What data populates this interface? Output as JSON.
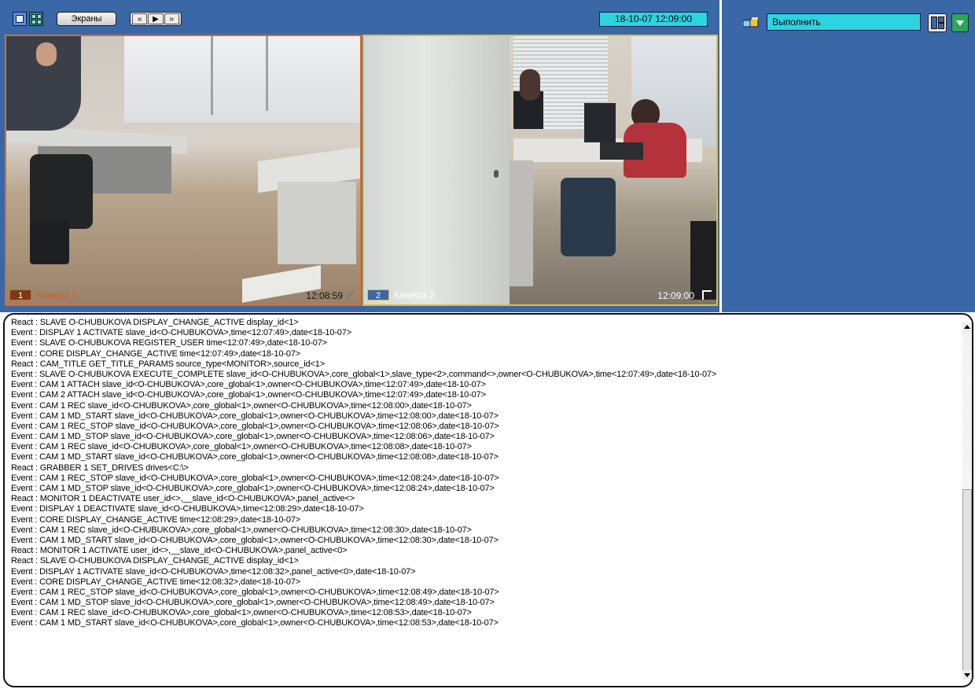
{
  "toolbar": {
    "screens_label": "Экраны",
    "nav_buttons": [
      "«",
      "▶",
      "»"
    ],
    "datetime": "18-10-07  12:09:00"
  },
  "cameras": [
    {
      "number": "1",
      "name": "Камера 1",
      "time": "12:08:59",
      "frame_color": "#e06a24"
    },
    {
      "number": "2",
      "name": "Камера 2",
      "time": "12:09:00",
      "frame_color": "#e0c034"
    }
  ],
  "command_panel": {
    "input_value": "Выполнить"
  },
  "colors": {
    "panel_bg": "#3a67a6",
    "accent_cyan": "#2ed3e0",
    "selected_row": "#0a246a"
  },
  "log": {
    "selected_index": 34,
    "lines": [
      "React : SLAVE O-CHUBUKOVA DISPLAY_CHANGE_ACTIVE display_id<1>",
      "Event : DISPLAY 1 ACTIVATE slave_id<O-CHUBUKOVA>,time<12:07:49>,date<18-10-07>",
      "Event : SLAVE O-CHUBUKOVA REGISTER_USER time<12:07:49>,date<18-10-07>",
      "Event : CORE  DISPLAY_CHANGE_ACTIVE time<12:07:49>,date<18-10-07>",
      "React : CAM_TITLE  GET_TITLE_PARAMS source_type<MONITOR>,source_id<1>",
      "Event : SLAVE O-CHUBUKOVA EXECUTE_COMPLETE slave_id<O-CHUBUKOVA>,core_global<1>,slave_type<2>,command<>,owner<O-CHUBUKOVA>,time<12:07:49>,date<18-10-07>",
      "Event : CAM 1 ATTACH slave_id<O-CHUBUKOVA>,core_global<1>,owner<O-CHUBUKOVA>,time<12:07:49>,date<18-10-07>",
      "Event : CAM 2 ATTACH slave_id<O-CHUBUKOVA>,core_global<1>,owner<O-CHUBUKOVA>,time<12:07:49>,date<18-10-07>",
      "Event : CAM 1 REC slave_id<O-CHUBUKOVA>,core_global<1>,owner<O-CHUBUKOVA>,time<12:08:00>,date<18-10-07>",
      "Event : CAM 1 MD_START slave_id<O-CHUBUKOVA>,core_global<1>,owner<O-CHUBUKOVA>,time<12:08:00>,date<18-10-07>",
      "Event : CAM 1 REC_STOP slave_id<O-CHUBUKOVA>,core_global<1>,owner<O-CHUBUKOVA>,time<12:08:06>,date<18-10-07>",
      "Event : CAM 1 MD_STOP slave_id<O-CHUBUKOVA>,core_global<1>,owner<O-CHUBUKOVA>,time<12:08:06>,date<18-10-07>",
      "Event : CAM 1 REC slave_id<O-CHUBUKOVA>,core_global<1>,owner<O-CHUBUKOVA>,time<12:08:08>,date<18-10-07>",
      "Event : CAM 1 MD_START slave_id<O-CHUBUKOVA>,core_global<1>,owner<O-CHUBUKOVA>,time<12:08:08>,date<18-10-07>",
      "React : GRABBER 1 SET_DRIVES drives<C:\\>",
      "Event : CAM 1 REC_STOP slave_id<O-CHUBUKOVA>,core_global<1>,owner<O-CHUBUKOVA>,time<12:08:24>,date<18-10-07>",
      "Event : CAM 1 MD_STOP slave_id<O-CHUBUKOVA>,core_global<1>,owner<O-CHUBUKOVA>,time<12:08:24>,date<18-10-07>",
      "React : MONITOR 1 DEACTIVATE user_id<>,__slave_id<O-CHUBUKOVA>,panel_active<>",
      "Event : DISPLAY 1 DEACTIVATE slave_id<O-CHUBUKOVA>,time<12:08:29>,date<18-10-07>",
      "Event : CORE  DISPLAY_CHANGE_ACTIVE time<12:08:29>,date<18-10-07>",
      "Event : CAM 1 REC slave_id<O-CHUBUKOVA>,core_global<1>,owner<O-CHUBUKOVA>,time<12:08:30>,date<18-10-07>",
      "Event : CAM 1 MD_START slave_id<O-CHUBUKOVA>,core_global<1>,owner<O-CHUBUKOVA>,time<12:08:30>,date<18-10-07>",
      "React : MONITOR 1 ACTIVATE user_id<>,__slave_id<O-CHUBUKOVA>,panel_active<0>",
      "React : SLAVE O-CHUBUKOVA DISPLAY_CHANGE_ACTIVE display_id<1>",
      "Event : DISPLAY 1 ACTIVATE slave_id<O-CHUBUKOVA>,time<12:08:32>,panel_active<0>,date<18-10-07>",
      "Event : CORE  DISPLAY_CHANGE_ACTIVE time<12:08:32>,date<18-10-07>",
      "Event : CAM 1 REC_STOP slave_id<O-CHUBUKOVA>,core_global<1>,owner<O-CHUBUKOVA>,time<12:08:49>,date<18-10-07>",
      "Event : CAM 1 MD_STOP slave_id<O-CHUBUKOVA>,core_global<1>,owner<O-CHUBUKOVA>,time<12:08:49>,date<18-10-07>",
      "Event : CAM 1 REC slave_id<O-CHUBUKOVA>,core_global<1>,owner<O-CHUBUKOVA>,time<12:08:53>,date<18-10-07>",
      "Event : CAM 1 MD_START slave_id<O-CHUBUKOVA>,core_global<1>,owner<O-CHUBUKOVA>,time<12:08:53>,date<18-10-07>"
    ]
  }
}
